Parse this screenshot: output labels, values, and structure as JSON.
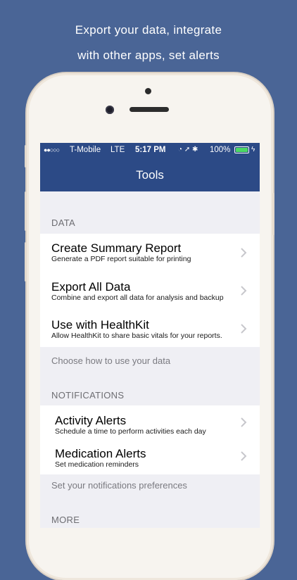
{
  "promo": {
    "line1": "Export your data, integrate",
    "line2": "with other apps, set alerts"
  },
  "status_bar": {
    "signal": "●●○○○",
    "carrier": "T-Mobile",
    "network": "LTE",
    "time": "5:17 PM",
    "icons": "◔ ➚ ✱",
    "battery_percent": "100%",
    "battery_level": 100,
    "battery_color": "#4cd964"
  },
  "nav": {
    "title": "Tools"
  },
  "sections": {
    "data": {
      "header": "DATA",
      "items": [
        {
          "title": "Create Summary Report",
          "subtitle": "Generate a PDF report suitable for printing"
        },
        {
          "title": "Export All Data",
          "subtitle": "Combine and export all data for analysis and backup"
        },
        {
          "title": "Use with HealthKit",
          "subtitle": "Allow HealthKit to share basic vitals for your reports."
        }
      ],
      "footer": "Choose how to use your data"
    },
    "notifications": {
      "header": "NOTIFICATIONS",
      "items": [
        {
          "title": "Activity Alerts",
          "subtitle": "Schedule a time to perform activities each day"
        },
        {
          "title": "Medication Alerts",
          "subtitle": "Set medication reminders"
        }
      ],
      "footer": "Set your notifications preferences"
    },
    "more": {
      "header": "MORE"
    }
  },
  "colors": {
    "background": "#4a6596",
    "nav_bar": "#2c4a86",
    "chevron": "#c7c7cc"
  }
}
